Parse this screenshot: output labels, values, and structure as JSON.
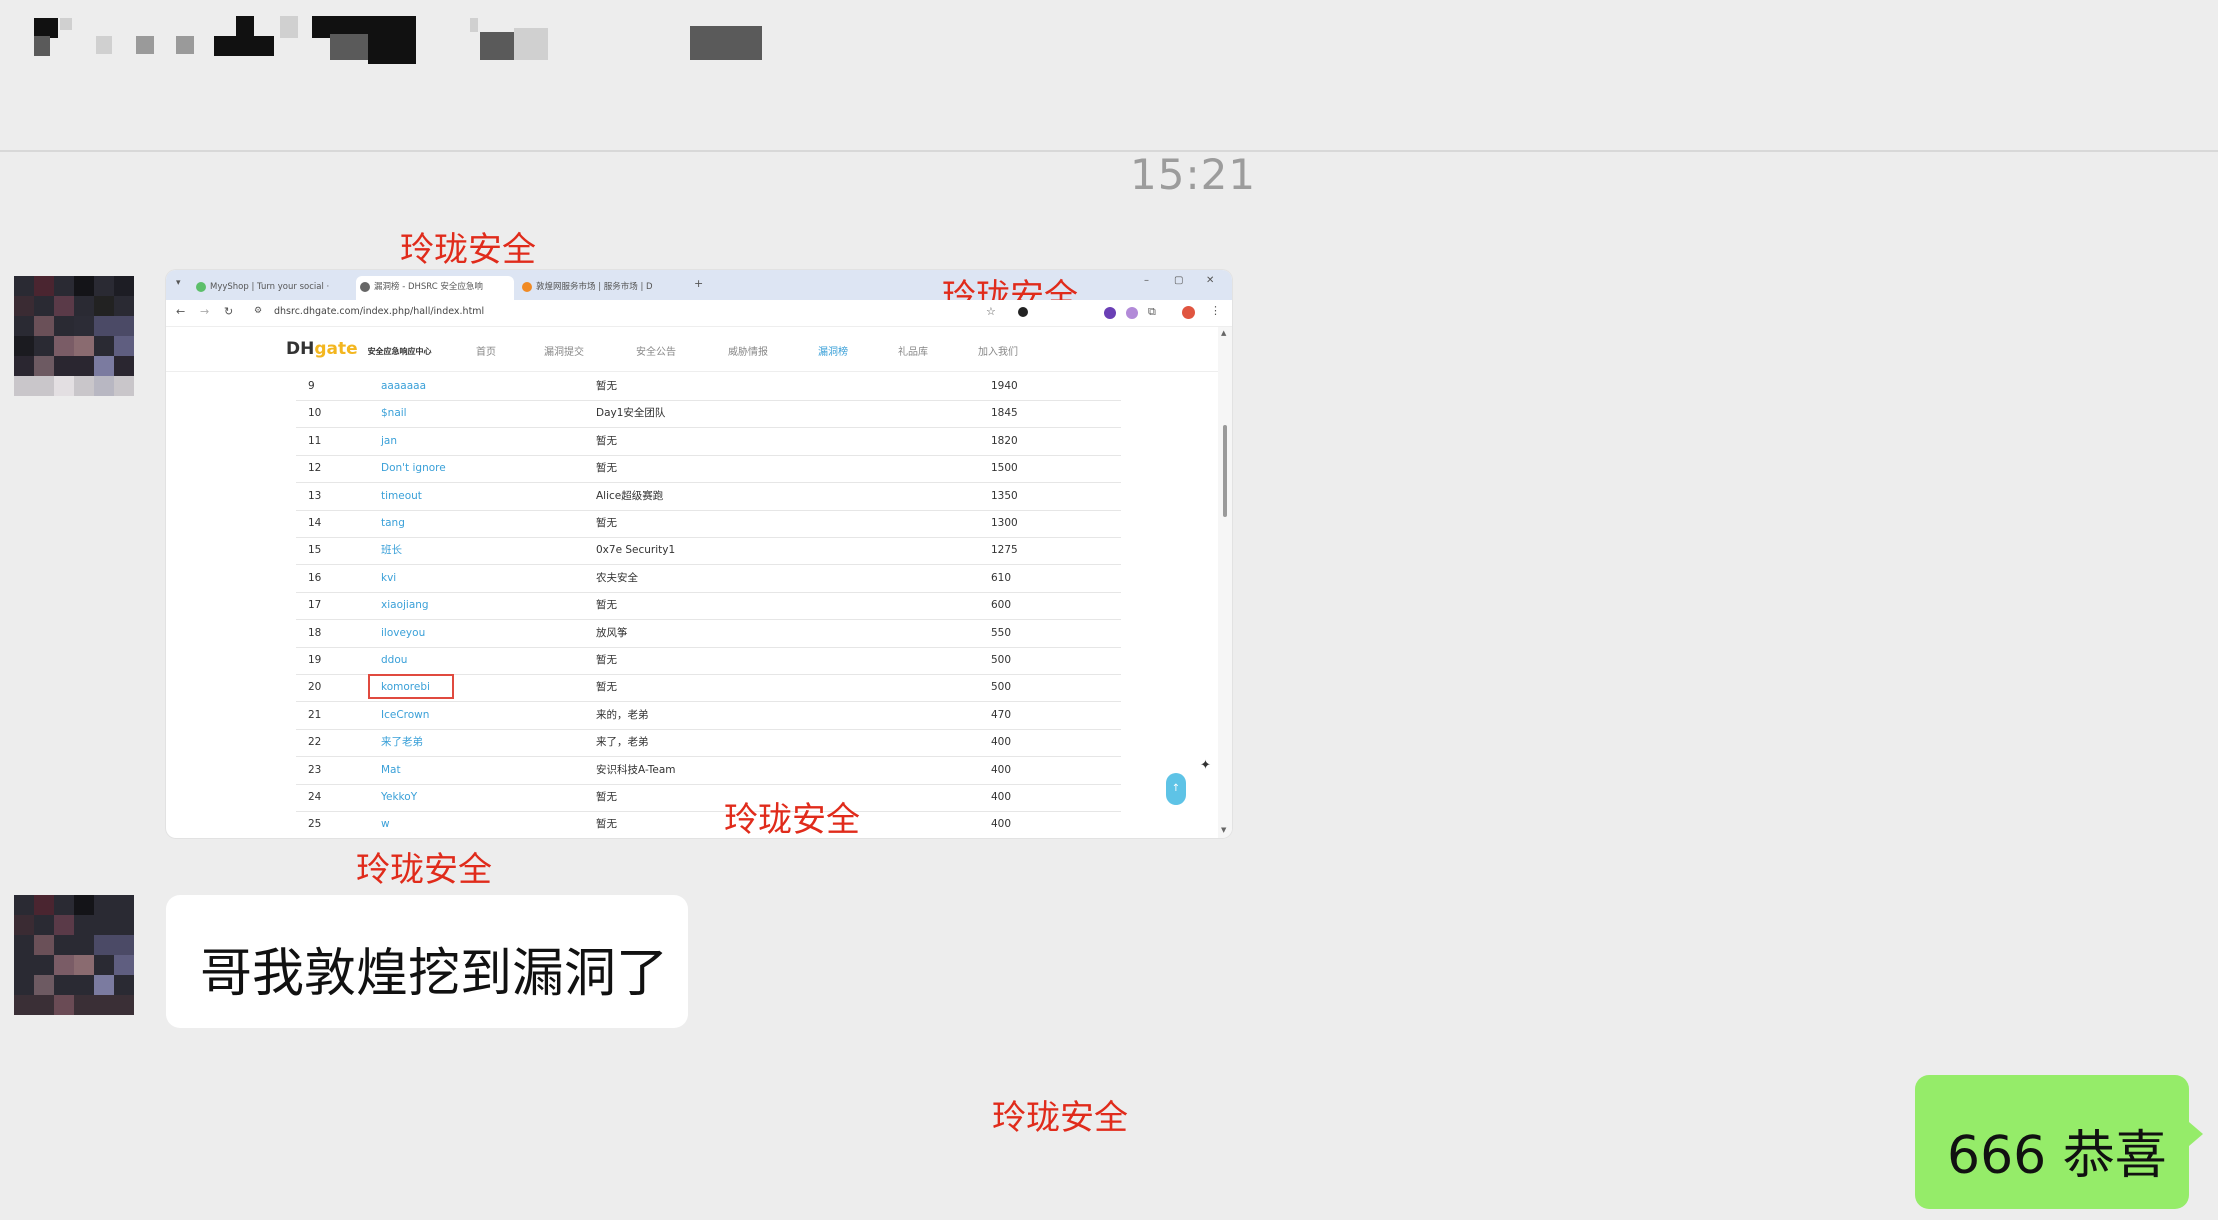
{
  "timestamp": "15:21",
  "watermarks": [
    "玲珑安全",
    "玲珑安全",
    "玲珑安全",
    "玲珑安全",
    "玲珑安全"
  ],
  "screenshot": {
    "tabs": [
      "MyyShop | Turn your social ·",
      "漏洞榜 - DHSRC 安全应急响",
      "敦煌网服务市场 | 服务市场 | D"
    ],
    "url": "dhsrc.dhgate.com/index.php/hall/index.html",
    "logo_main": "DH",
    "logo_accent": "gate",
    "logo_sub": "安全应急响应中心",
    "nav_items": [
      "首页",
      "漏洞提交",
      "安全公告",
      "威胁情报",
      "漏洞榜",
      "礼品库",
      "加入我们"
    ],
    "rows": [
      {
        "rank": "9",
        "name": "aaaaaaa",
        "team": "暂无",
        "score": "1940"
      },
      {
        "rank": "10",
        "name": "$nail",
        "team": "Day1安全团队",
        "score": "1845"
      },
      {
        "rank": "11",
        "name": "jan",
        "team": "暂无",
        "score": "1820"
      },
      {
        "rank": "12",
        "name": "Don't ignore",
        "team": "暂无",
        "score": "1500"
      },
      {
        "rank": "13",
        "name": "timeout",
        "team": "Alice超级赛跑",
        "score": "1350"
      },
      {
        "rank": "14",
        "name": "tang",
        "team": "暂无",
        "score": "1300"
      },
      {
        "rank": "15",
        "name": "班长",
        "team": "0x7e Security1",
        "score": "1275"
      },
      {
        "rank": "16",
        "name": "kvi",
        "team": "农夫安全",
        "score": "610"
      },
      {
        "rank": "17",
        "name": "xiaojiang",
        "team": "暂无",
        "score": "600"
      },
      {
        "rank": "18",
        "name": "iloveyou",
        "team": "放风筝",
        "score": "550"
      },
      {
        "rank": "19",
        "name": "ddou",
        "team": "暂无",
        "score": "500"
      },
      {
        "rank": "20",
        "name": "komorebi",
        "team": "暂无",
        "score": "500"
      },
      {
        "rank": "21",
        "name": "IceCrown",
        "team": "来的，老弟",
        "score": "470"
      },
      {
        "rank": "22",
        "name": "来了老弟",
        "team": "来了，老弟",
        "score": "400"
      },
      {
        "rank": "23",
        "name": "Mat",
        "team": "安识科技A-Team",
        "score": "400"
      },
      {
        "rank": "24",
        "name": "YekkoY",
        "team": "暂无",
        "score": "400"
      },
      {
        "rank": "25",
        "name": "w",
        "team": "暂无",
        "score": "400"
      }
    ]
  },
  "messages": {
    "incoming_text": "哥我敦煌挖到漏洞了",
    "outgoing_text": "666 恭喜"
  },
  "colors": {
    "watermark": "#e02b1b",
    "outgoing_bubble": "#95ec69",
    "link": "#3aa0d8"
  }
}
